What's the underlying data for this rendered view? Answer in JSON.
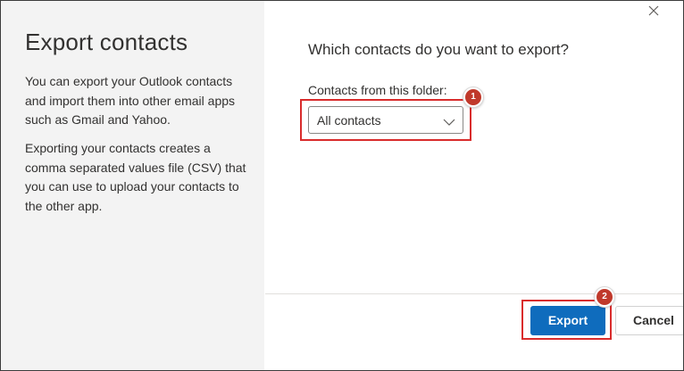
{
  "sidebar": {
    "title": "Export contacts",
    "paragraph_1": "You can export your Outlook contacts and import them into other email apps such as Gmail and Yahoo.",
    "paragraph_2": "Exporting your contacts creates a comma separated values file (CSV) that you can use to upload your contacts to the other app."
  },
  "main": {
    "question": "Which contacts do you want to export?",
    "folder_label": "Contacts from this folder:",
    "folder_select": {
      "selected": "All contacts"
    }
  },
  "footer": {
    "export_label": "Export",
    "cancel_label": "Cancel"
  },
  "annotations": {
    "step_1": "1",
    "step_2": "2",
    "highlight_color": "#d92c2c",
    "badge_color": "#c0392b"
  },
  "colors": {
    "accent": "#0f6cbd",
    "sidebar_bg": "#f3f3f3"
  },
  "icons": {
    "close": "close-icon",
    "dropdown": "chevron-down-icon"
  }
}
